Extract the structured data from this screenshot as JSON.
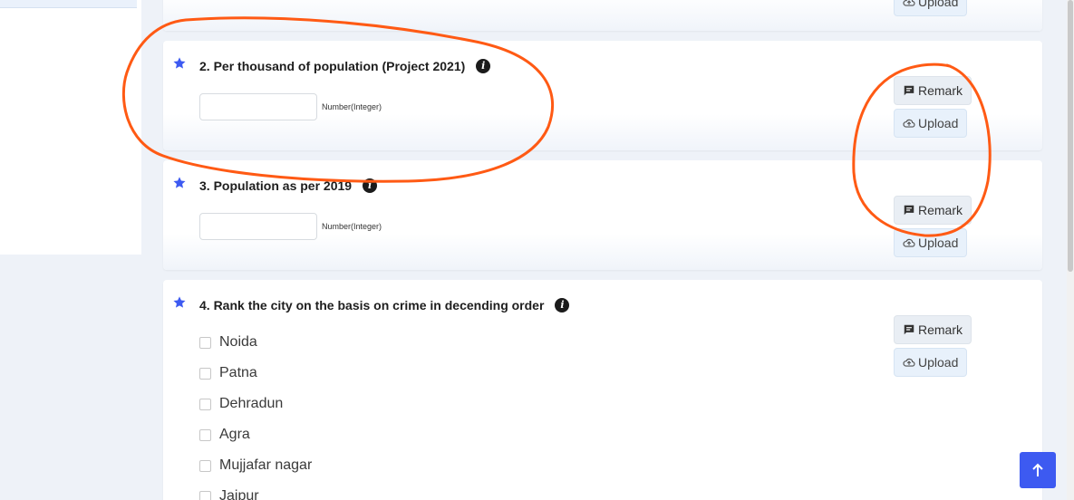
{
  "prev_card": {
    "upload_label": "Upload"
  },
  "questions": [
    {
      "title": "2. Per thousand of population (Project 2021)",
      "input_hint": "Number(Integer)",
      "remark_label": "Remark",
      "upload_label": "Upload"
    },
    {
      "title": "3. Population as per 2019",
      "input_hint": "Number(Integer)",
      "remark_label": "Remark",
      "upload_label": "Upload"
    },
    {
      "title": "4. Rank the city on the basis on crime in decending order",
      "remark_label": "Remark",
      "upload_label": "Upload",
      "options": [
        "Noida",
        "Patna",
        "Dehradun",
        "Agra",
        "Mujjafar nagar",
        "Jaipur"
      ]
    }
  ],
  "colors": {
    "accent": "#3d5af1",
    "star": "#3d5af1",
    "annotation": "#ff5a14"
  },
  "icons": {
    "star": "star-icon",
    "info": "info-icon",
    "remark": "comment-icon",
    "upload": "cloud-upload-icon",
    "scroll_top": "arrow-up-icon"
  }
}
